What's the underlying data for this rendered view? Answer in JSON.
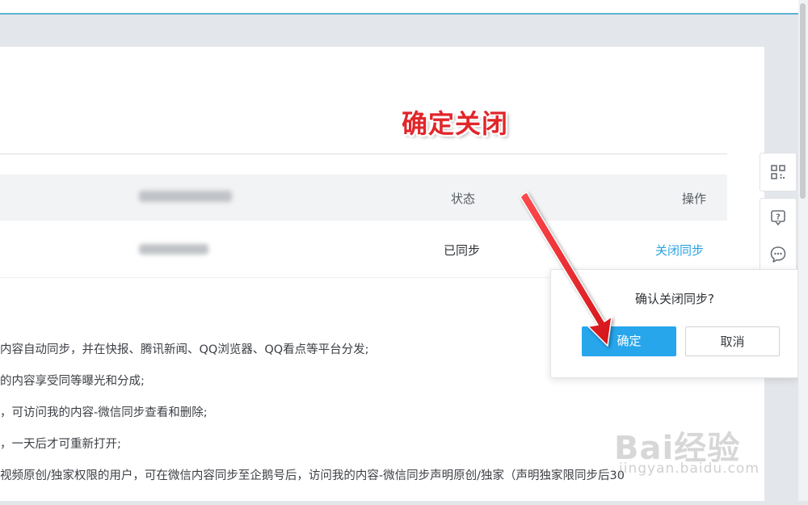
{
  "annotation": {
    "text": "确定关闭"
  },
  "table": {
    "headers": {
      "col2": "",
      "status": "状态",
      "action": "操作"
    },
    "rows": [
      {
        "name": "",
        "status": "已同步",
        "action": "关闭同步"
      }
    ]
  },
  "description_lines": [
    "内容自动同步，并在快报、腾讯新闻、QQ浏览器、QQ看点等平台分发;",
    "的内容享受同等曝光和分成;",
    "，可访问我的内容-微信同步查看和删除;",
    "，一天后才可重新打开;",
    "视频原创/独家权限的用户，可在微信内容同步至企鹅号后，访问我的内容-微信同步声明原创/独家（声明独家限同步后30"
  ],
  "confirm_popover": {
    "title": "确认关闭同步?",
    "ok_label": "确定",
    "cancel_label": "取消"
  },
  "side_tools": {
    "icons": [
      "qrcode-icon",
      "help-icon",
      "feedback-icon"
    ]
  },
  "watermark": {
    "main": "Bai经验",
    "sub": "jingyan.baidu.com"
  },
  "colors": {
    "accent": "#27a6ec",
    "link": "#2aa3e0",
    "annotation": "#e1262a",
    "arrow": "#e81d22"
  }
}
